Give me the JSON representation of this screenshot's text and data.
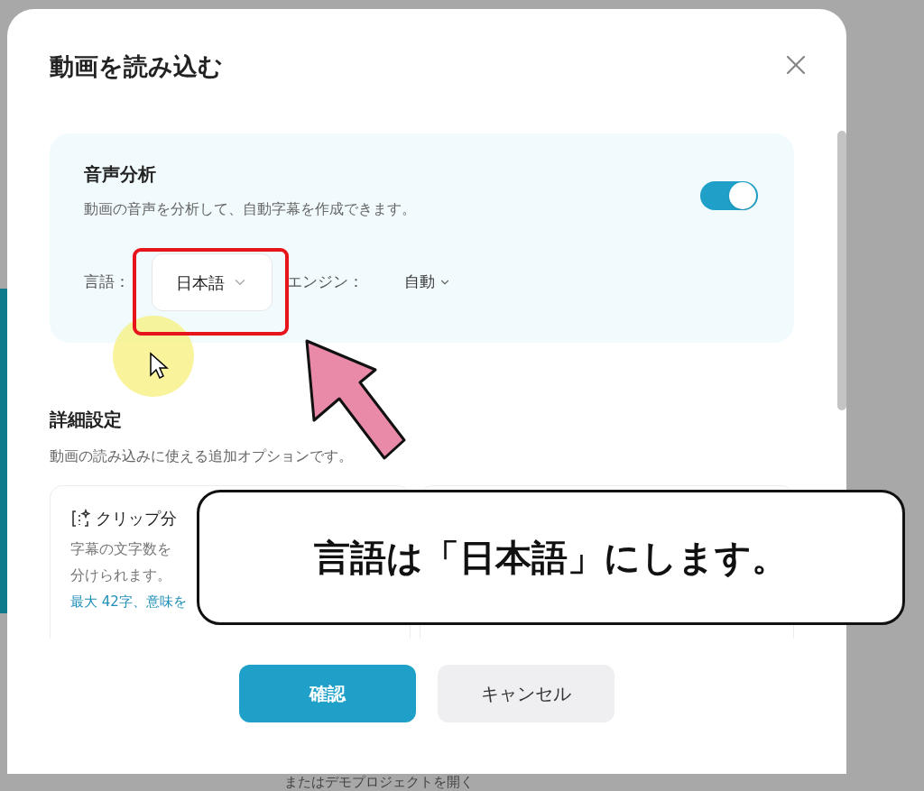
{
  "dialog": {
    "title": "動画を読み込む",
    "audio_analysis": {
      "title": "音声分析",
      "description": "動画の音声を分析して、自動字幕を作成できます。",
      "enabled": true,
      "language_label": "言語：",
      "language": "日本語",
      "engine_label": "エンジン：",
      "engine": "自動"
    },
    "advanced": {
      "title": "詳細設定",
      "description": "動画の読み込みに使える追加オプションです。",
      "cards": [
        {
          "title": "クリップ分",
          "lines": [
            "字幕の文字数を",
            "分けられます。"
          ],
          "link": "最大 42字、意味を"
        }
      ]
    },
    "buttons": [
      {
        "label": "確認",
        "kind": "primary"
      },
      {
        "label": "キャンセル",
        "kind": "secondary"
      }
    ]
  },
  "background_link": "またはデモプロジェクトを開く",
  "caption": "言語は「日本語」にします。"
}
